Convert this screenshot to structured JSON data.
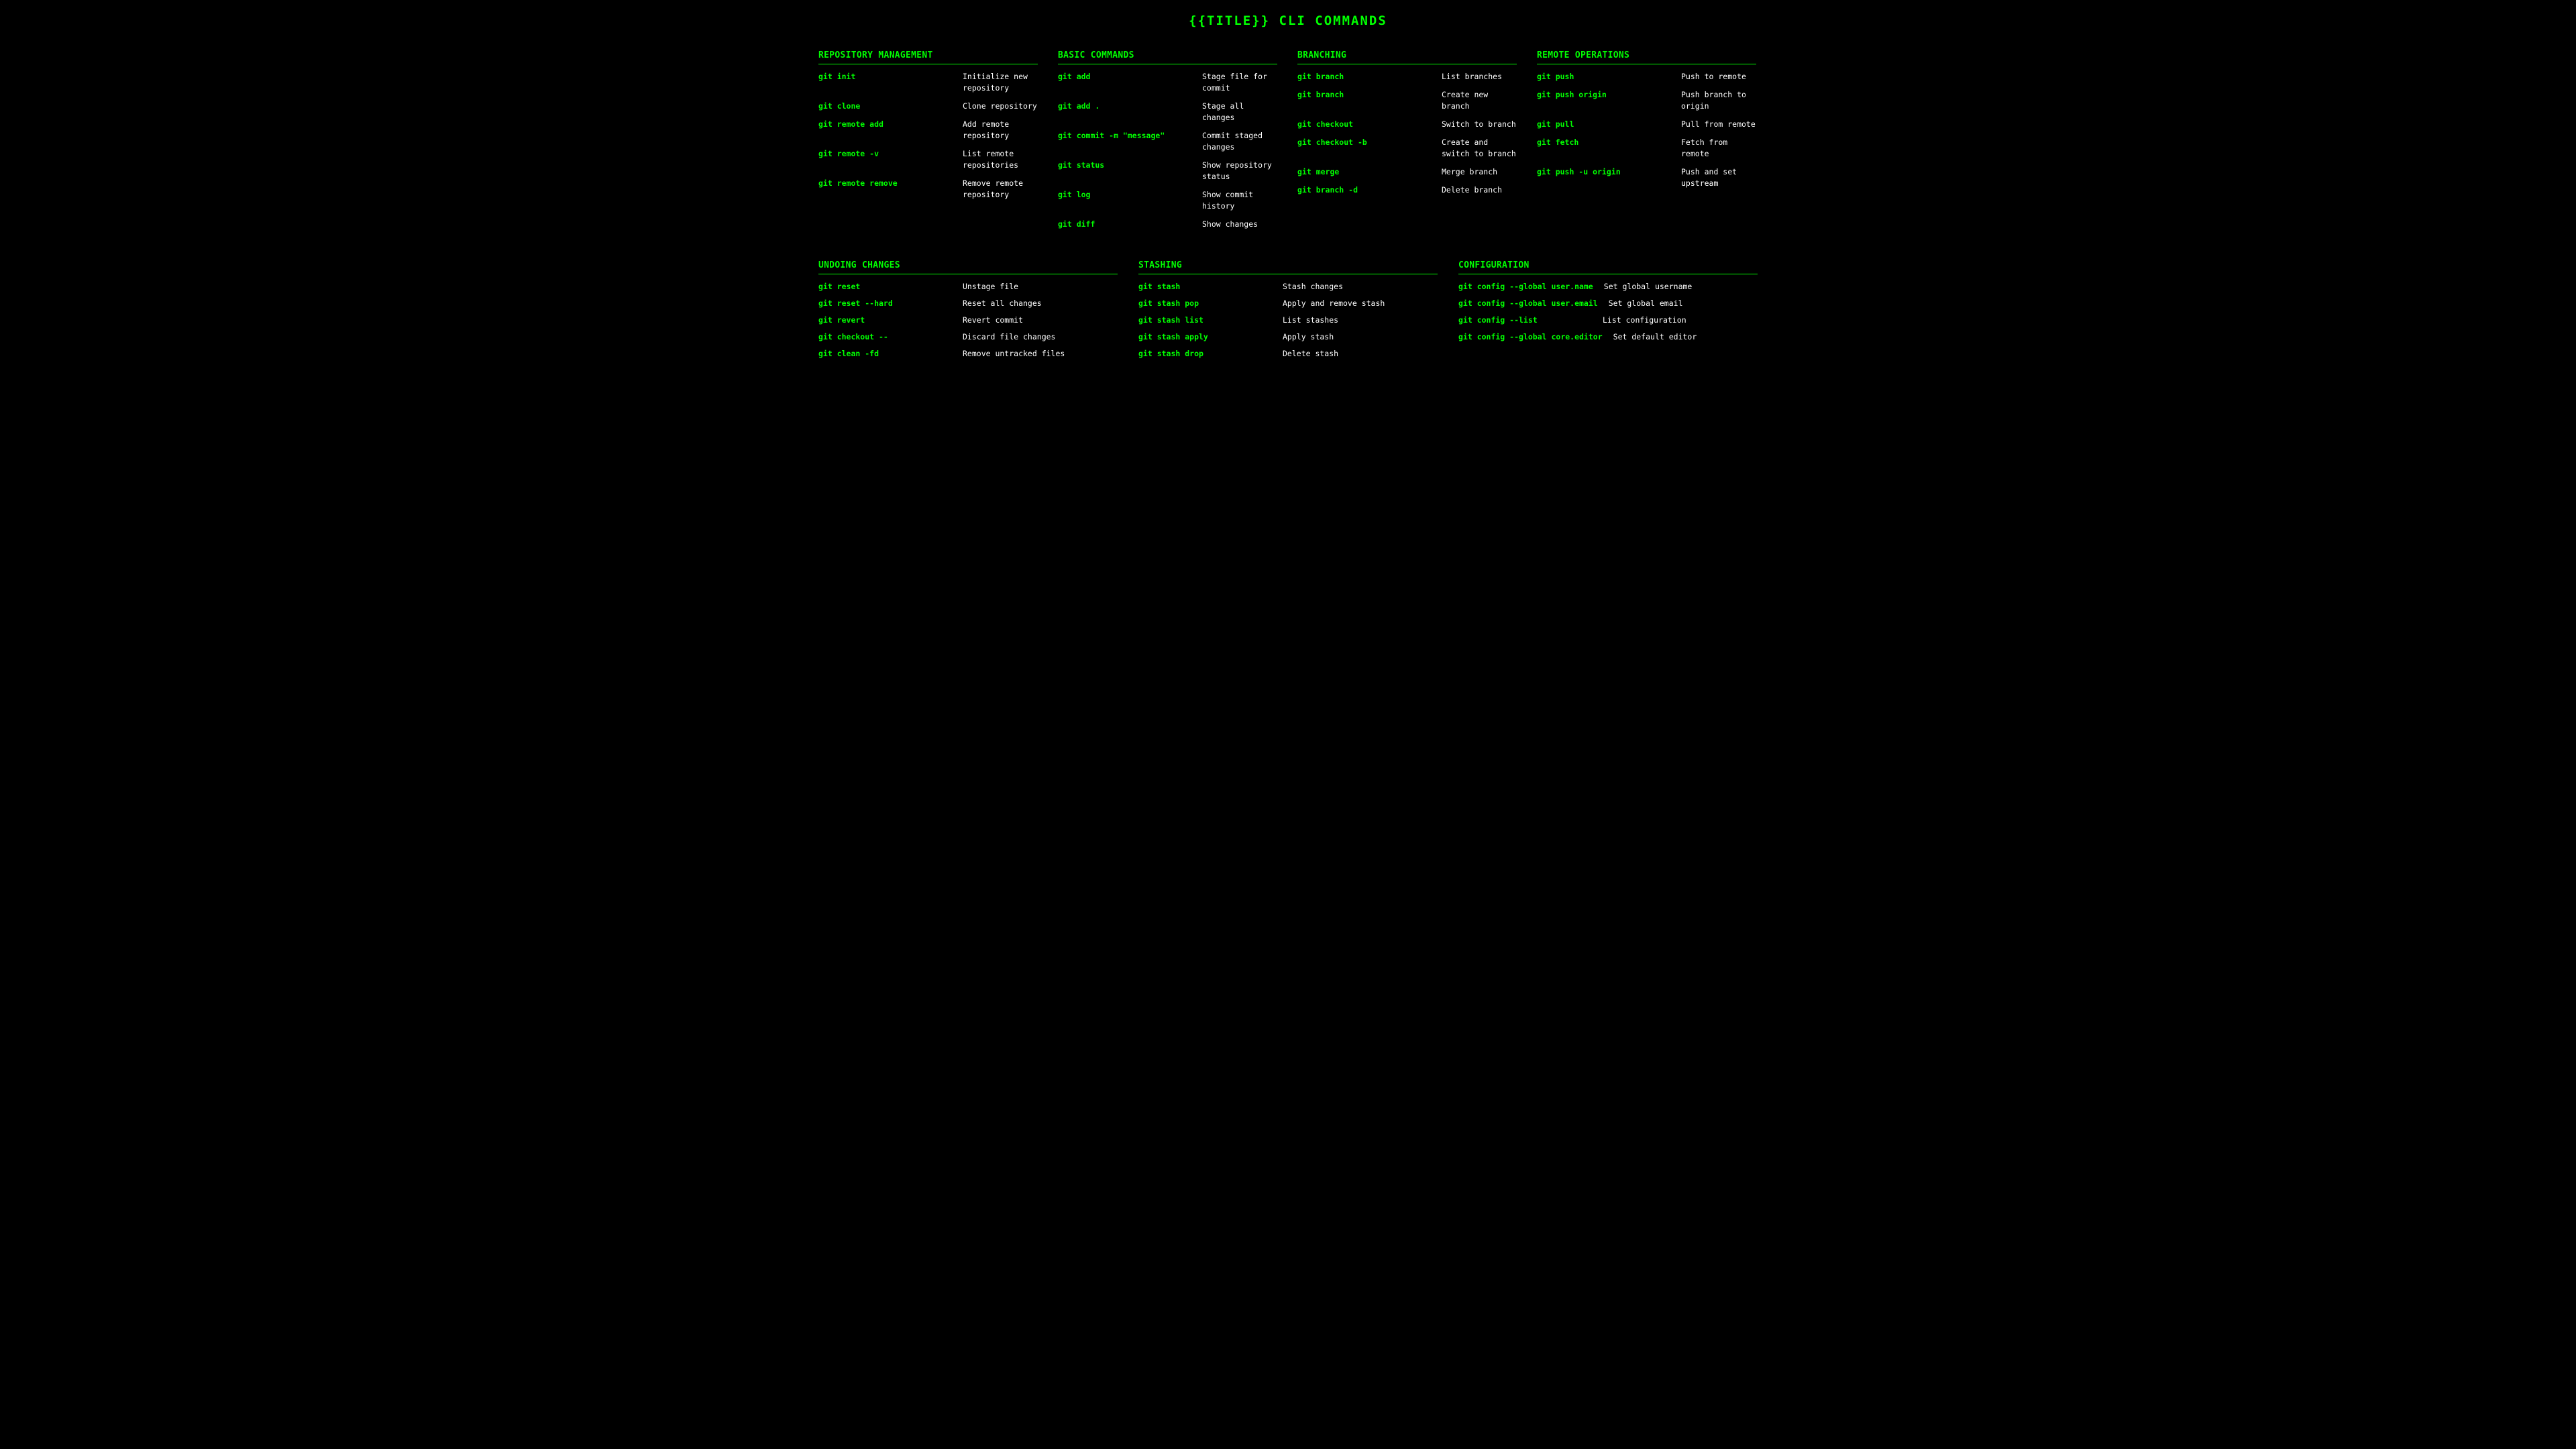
{
  "title": "{{TITLE}} CLI COMMANDS",
  "colors": {
    "accent": "#00ff00",
    "background": "#000000",
    "text": "#ffffff"
  },
  "sections_top": [
    {
      "title": "REPOSITORY MANAGEMENT",
      "commands": [
        {
          "cmd": "git init",
          "desc": "Initialize new repository"
        },
        {
          "cmd": "git clone",
          "desc": "Clone repository"
        },
        {
          "cmd": "git remote add",
          "desc": "Add remote repository"
        },
        {
          "cmd": "git remote -v",
          "desc": "List remote repositories"
        },
        {
          "cmd": "git remote remove",
          "desc": "Remove remote repository"
        }
      ]
    },
    {
      "title": "BASIC COMMANDS",
      "commands": [
        {
          "cmd": "git add",
          "desc": "Stage file for commit"
        },
        {
          "cmd": "git add .",
          "desc": "Stage all changes"
        },
        {
          "cmd": "git commit -m \"message\"",
          "desc": "Commit staged changes"
        },
        {
          "cmd": "git status",
          "desc": "Show repository status"
        },
        {
          "cmd": "git log",
          "desc": "Show commit history"
        },
        {
          "cmd": "git diff",
          "desc": "Show changes"
        }
      ]
    },
    {
      "title": "BRANCHING",
      "commands": [
        {
          "cmd": "git branch",
          "desc": "List branches"
        },
        {
          "cmd": "git branch",
          "desc": "Create new branch"
        },
        {
          "cmd": "git checkout",
          "desc": "Switch to branch"
        },
        {
          "cmd": "git checkout -b",
          "desc": "Create and switch to branch"
        },
        {
          "cmd": "git merge",
          "desc": "Merge branch"
        },
        {
          "cmd": "git branch -d",
          "desc": "Delete branch"
        }
      ]
    },
    {
      "title": "REMOTE OPERATIONS",
      "commands": [
        {
          "cmd": "git push",
          "desc": "Push to remote"
        },
        {
          "cmd": "git push origin",
          "desc": "Push branch to origin"
        },
        {
          "cmd": "git pull",
          "desc": "Pull from remote"
        },
        {
          "cmd": "git fetch",
          "desc": "Fetch from remote"
        },
        {
          "cmd": "git push -u origin",
          "desc": "Push and set upstream"
        }
      ]
    }
  ],
  "sections_bottom": [
    {
      "title": "UNDOING CHANGES",
      "commands": [
        {
          "cmd": "git reset",
          "desc": "Unstage file"
        },
        {
          "cmd": "git reset --hard",
          "desc": "Reset all changes"
        },
        {
          "cmd": "git revert",
          "desc": "Revert commit"
        },
        {
          "cmd": "git checkout --",
          "desc": "Discard file changes"
        },
        {
          "cmd": "git clean -fd",
          "desc": "Remove untracked files"
        }
      ]
    },
    {
      "title": "STASHING",
      "commands": [
        {
          "cmd": "git stash",
          "desc": "Stash changes"
        },
        {
          "cmd": "git stash pop",
          "desc": "Apply and remove stash"
        },
        {
          "cmd": "git stash list",
          "desc": "List stashes"
        },
        {
          "cmd": "git stash apply",
          "desc": "Apply stash"
        },
        {
          "cmd": "git stash drop",
          "desc": "Delete stash"
        }
      ]
    },
    {
      "title": "CONFIGURATION",
      "commands": [
        {
          "cmd": "git config --global user.name",
          "desc": "Set global username"
        },
        {
          "cmd": "git config --global user.email",
          "desc": "Set global email"
        },
        {
          "cmd": "git config --list",
          "desc": "List configuration"
        },
        {
          "cmd": "git config --global core.editor",
          "desc": "Set default editor"
        }
      ]
    }
  ]
}
